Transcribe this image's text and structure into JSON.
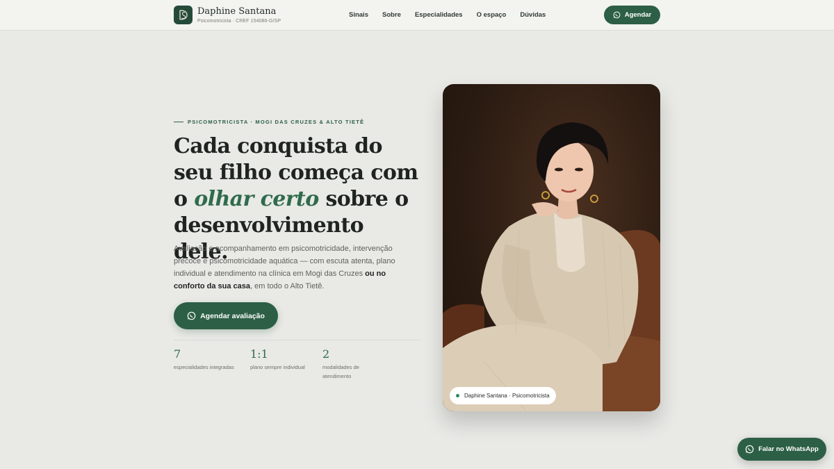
{
  "brand": {
    "name": "Daphine Santana",
    "subtitle": "Psicomotricista · CREF 154086-G/SP",
    "logo_text": "DS"
  },
  "nav": {
    "items": [
      "Sinais",
      "Sobre",
      "Especialidades",
      "O espaço",
      "Dúvidas"
    ]
  },
  "header": {
    "cta_label": "Agendar"
  },
  "hero": {
    "eyebrow": "PSICOMOTRICISTA · MOGI DAS CRUZES & ALTO TIETÊ",
    "headline_before": "Cada conquista do seu filho começa com o ",
    "headline_accent": "olhar certo",
    "headline_after": " sobre o desenvolvimento dele.",
    "description_part1": "Avaliação e acompanhamento em psicomotricidade, intervenção precoce e psicomotricidade aquática — com escuta atenta, plano individual e atendimento na clínica em Mogi das Cruzes ",
    "description_bold": "ou no conforto da sua casa",
    "description_part2": ", em todo o Alto Tietê.",
    "cta_label": "Agendar avaliação"
  },
  "stats": [
    {
      "value": "7",
      "label": "especialidades integradas"
    },
    {
      "value": "1:1",
      "label": "plano sempre individual"
    },
    {
      "value": "2",
      "label": "modalidades de atendimento"
    }
  ],
  "photo": {
    "badge": "Daphine Santana · Psicomotricista"
  },
  "floating": {
    "whatsapp_label": "Falar no WhatsApp"
  },
  "colors": {
    "accent": "#2c5f45",
    "background": "#e9e9e6",
    "accent_text": "#2f6b4c"
  },
  "icons": {
    "whatsapp": "whatsapp-icon"
  }
}
